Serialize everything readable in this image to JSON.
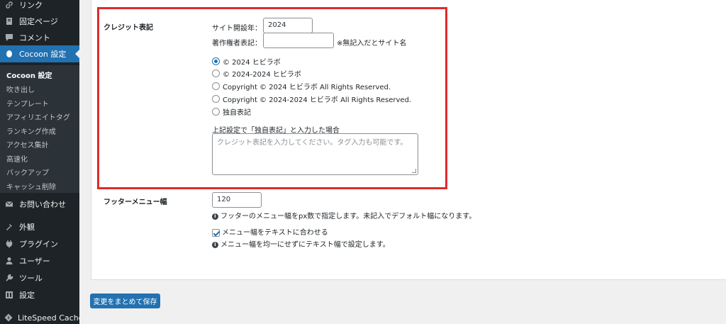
{
  "sidebar": {
    "items": [
      {
        "label": "リンク",
        "icon": "link-icon"
      },
      {
        "label": "固定ページ",
        "icon": "pages-icon"
      },
      {
        "label": "コメント",
        "icon": "comment-icon"
      },
      {
        "label": "Cocoon 設定",
        "icon": "cocoon-icon"
      }
    ],
    "submenu": [
      "Cocoon 設定",
      "吹き出し",
      "テンプレート",
      "アフィリエイトタグ",
      "ランキング作成",
      "アクセス集計",
      "高速化",
      "バックアップ",
      "キャッシュ削除"
    ],
    "lower_items": [
      {
        "label": "お問い合わせ",
        "icon": "mail-icon"
      },
      {
        "label": "外観",
        "icon": "appearance-icon"
      },
      {
        "label": "プラグイン",
        "icon": "plugin-icon"
      },
      {
        "label": "ユーザー",
        "icon": "user-icon"
      },
      {
        "label": "ツール",
        "icon": "tools-icon"
      },
      {
        "label": "設定",
        "icon": "settings-icon"
      },
      {
        "label": "LiteSpeed Cache",
        "icon": "litespeed-icon"
      }
    ]
  },
  "credit": {
    "section_label": "クレジット表記",
    "site_year_label": "サイト開設年：",
    "site_year_value": "2024",
    "author_label": "著作権者表記：",
    "author_value": "",
    "author_note": "※無記入だとサイト名",
    "options": [
      {
        "label": "© 2024 ヒビラボ",
        "checked": true
      },
      {
        "label": "© 2024-2024 ヒビラボ",
        "checked": false
      },
      {
        "label": "Copyright © 2024 ヒビラボ All Rights Reserved.",
        "checked": false
      },
      {
        "label": "Copyright © 2024-2024 ヒビラボ All Rights Reserved.",
        "checked": false
      },
      {
        "label": "独自表記",
        "checked": false
      }
    ],
    "custom_label": "上記設定で「独自表記」と入力した場合",
    "custom_placeholder": "クレジット表記を入力してください。タグ入力も可能です。"
  },
  "footer_menu": {
    "label": "フッターメニュー幅",
    "width_value": "120",
    "width_help": "フッターのメニュー幅をpx数で指定します。未記入でデフォルト幅になります。",
    "fit_text_label": "メニュー幅をテキストに合わせる",
    "fit_text_checked": true,
    "fit_text_help": "メニュー幅を均一にせずにテキスト幅で設定します。"
  },
  "save_button_label": "変更をまとめて保存",
  "colors": {
    "accent": "#2271b1",
    "sidebar_bg": "#1d2327",
    "highlight_border": "#e02b2b"
  }
}
